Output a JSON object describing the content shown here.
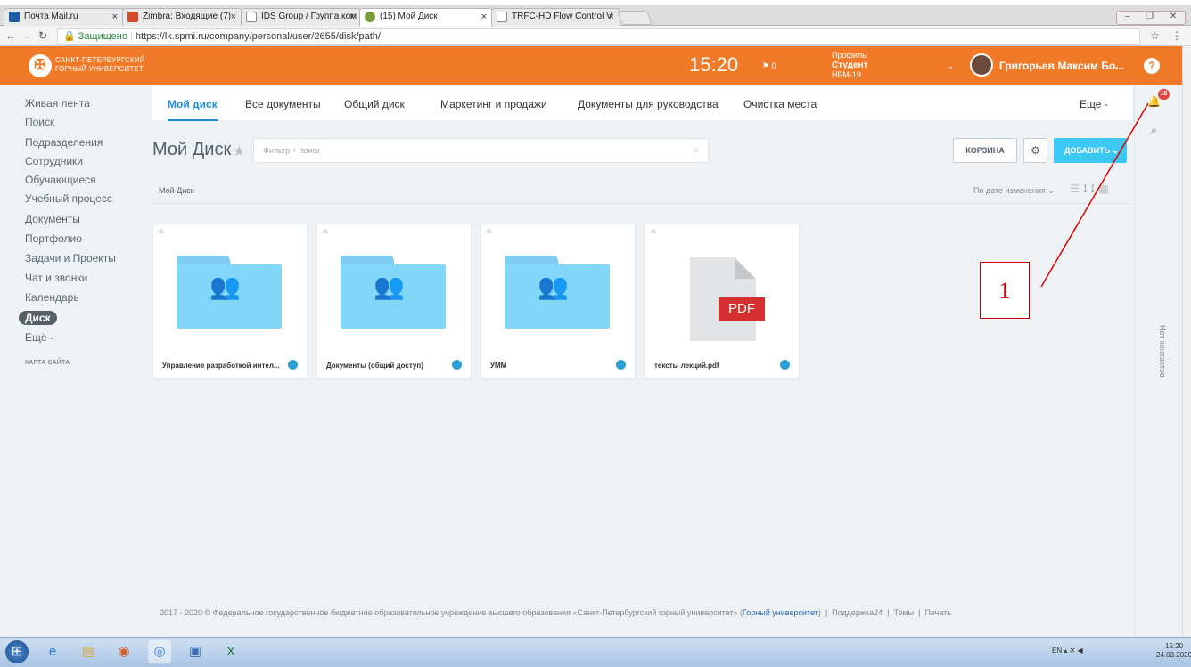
{
  "browser": {
    "tabs": [
      {
        "label": "Почта Mail.ru",
        "color": "#1b5aa8"
      },
      {
        "label": "Zimbra: Входящие (7)",
        "color": "#d04a2a"
      },
      {
        "label": "IDS Group / Группа ком",
        "color": "#888888"
      },
      {
        "label": "(15) Мой Диск",
        "color": "#7a9a3a"
      },
      {
        "label": "TRFC-HD Flow Control V",
        "color": "#888888"
      }
    ],
    "secure_label": "Защищено",
    "url": "https://lk.spmi.ru/company/personal/user/2655/disk/path/"
  },
  "header": {
    "logo_line1": "САНКТ-ПЕТЕРБУРГСКИЙ",
    "logo_line2": "ГОРНЫЙ УНИВЕРСИТЕТ",
    "time": "15:20",
    "flag_count": "0",
    "profile_label": "Профиль",
    "profile_role": "Студент",
    "profile_group": "НРМ-19",
    "user_name": "Григорьев Максим Бо...",
    "help": "?"
  },
  "sidebar": {
    "items": [
      "Живая лента",
      "Поиск",
      "Подразделения",
      "Сотрудники",
      "Обучающиеся",
      "Учебный процесс",
      "Документы",
      "Портфолио",
      "Задачи и Проекты",
      "Чат и звонки",
      "Календарь",
      "Диск",
      "Ещё -"
    ],
    "sitemap": "КАРТА САЙТА"
  },
  "topnav": {
    "tabs": [
      "Мой диск",
      "Все документы",
      "Общий диск",
      "Маркетинг и продажи",
      "Документы для руководства",
      "Очистка места"
    ],
    "more": "Еще -"
  },
  "toolbar": {
    "title": "Мой Диск",
    "filter_placeholder": "Фильтр + поиск",
    "trash": "КОРЗИНА",
    "add": "ДОБАВИТЬ"
  },
  "crumbs": {
    "path": "Мой Диск",
    "sort": "По дате изменения"
  },
  "files": [
    {
      "name": "Управление разработкой интел...",
      "type": "folder"
    },
    {
      "name": "Документы (общий доступ)",
      "type": "folder"
    },
    {
      "name": "УММ",
      "type": "folder"
    },
    {
      "name": "тексты лекций.pdf",
      "type": "pdf"
    }
  ],
  "pdf_label": "PDF",
  "right_rail": {
    "badge": "15",
    "no_contacts": "Нет контактов"
  },
  "annotation": "1",
  "footer": {
    "text": "2017 - 2020 © Федеральное государственное бюджетное образовательное учреждение высшего образования «Санкт-Петербургский горный университет» (",
    "link": "Горный университет",
    "close": ")",
    "support": "Поддержка24",
    "themes": "Темы",
    "print": "Печать"
  },
  "taskbar": {
    "lang": "EN",
    "time": "15:20",
    "date": "24.03.2020"
  }
}
